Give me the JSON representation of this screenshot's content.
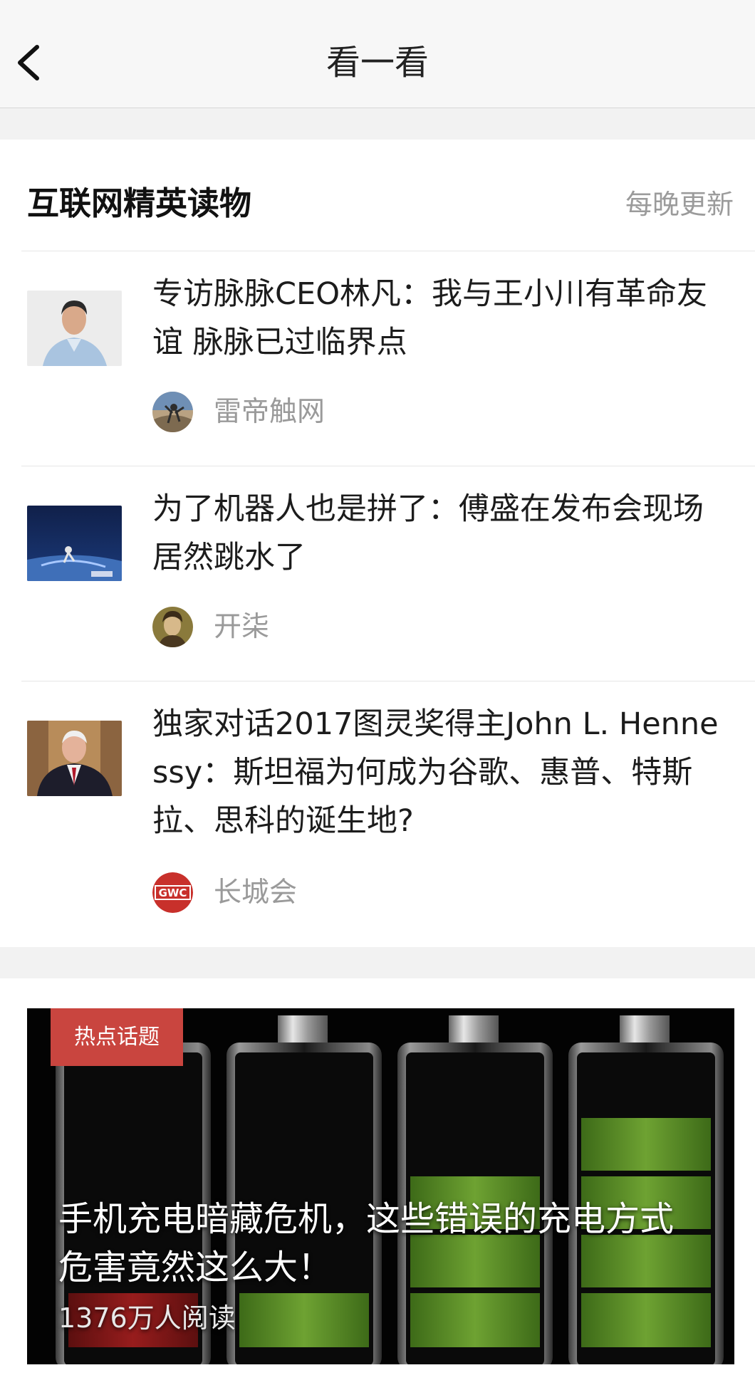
{
  "nav": {
    "title": "看一看",
    "back_icon": "chevron-left-icon"
  },
  "section": {
    "title": "互联网精英读物",
    "update_note": "每晚更新"
  },
  "articles": [
    {
      "title": "专访脉脉CEO林凡：我与王小川有革命友谊 脉脉已过临界点",
      "source": "雷帝触网"
    },
    {
      "title": "为了机器人也是拼了：傅盛在发布会现场居然跳水了",
      "source": "开柒"
    },
    {
      "title": "独家对话2017图灵奖得主John L. Hennessy：斯坦福为何成为谷歌、惠普、特斯拉、思科的诞生地?",
      "source": "长城会",
      "source_logo_text": "GWC"
    }
  ],
  "hot_topic": {
    "badge": "热点话题",
    "title": "手机充电暗藏危机，这些错误的充电方式危害竟然这么大！",
    "reads": "1376万人阅读",
    "image": "battery-levels-image"
  },
  "colors": {
    "badge": "#c9453f",
    "muted_text": "#9b9b9b",
    "battery_green": "#5a8a2a"
  }
}
